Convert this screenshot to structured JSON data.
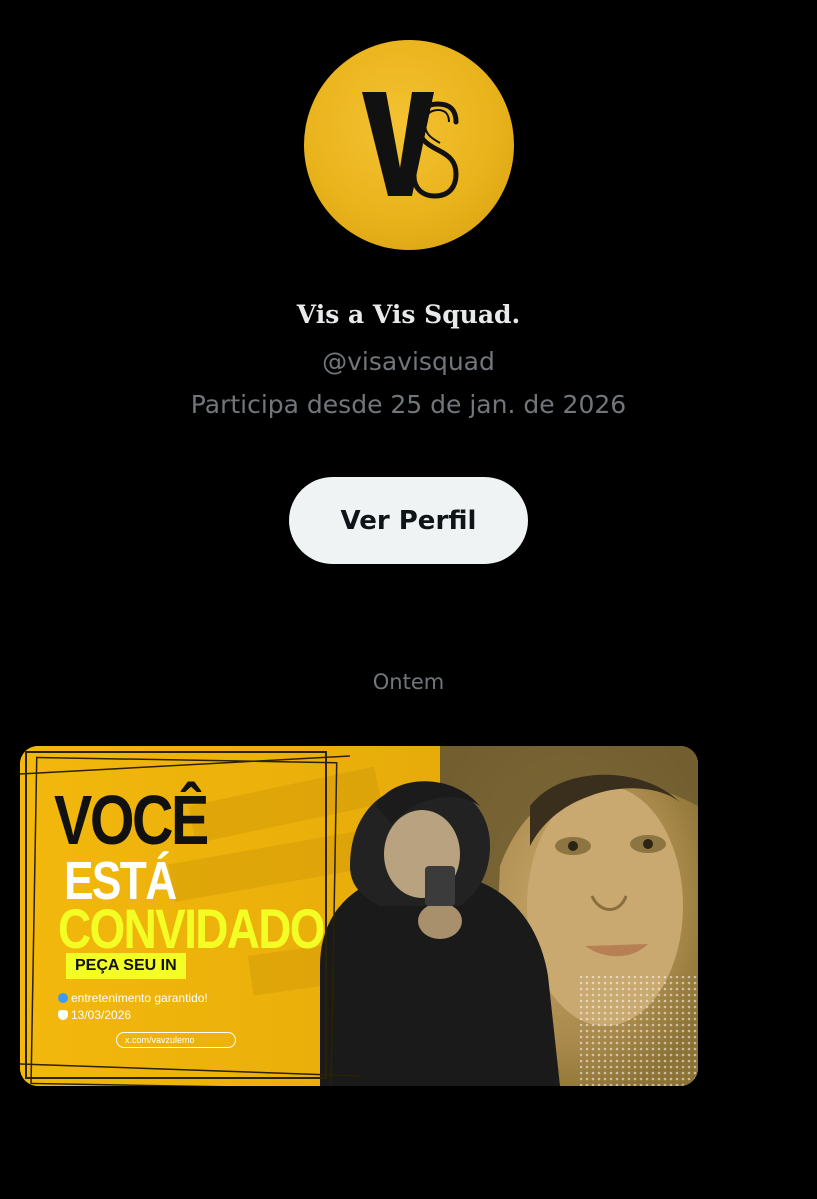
{
  "profile": {
    "avatar_lettering": "VS",
    "display_name": "Vis a Vis Squad.",
    "handle": "@visavisquad",
    "joined": "Participa desde 25 de jan. de 2026",
    "view_profile_label": "Ver Perfil"
  },
  "conversation": {
    "date_separator": "Ontem"
  },
  "media": {
    "headline_1": "VOCÊ",
    "headline_2": "ESTÁ",
    "headline_3": "CONVIDADO",
    "cta": "PEÇA SEU IN",
    "tagline": "entretenimento garantido!",
    "event_date": "13/03/2026",
    "link": "x.com/vavzulemo"
  },
  "colors": {
    "background": "#000000",
    "brand_yellow": "#e9b31c",
    "button_bg": "#eff3f4",
    "secondary_text": "#71767b",
    "banner_highlight": "#f3ff24"
  }
}
